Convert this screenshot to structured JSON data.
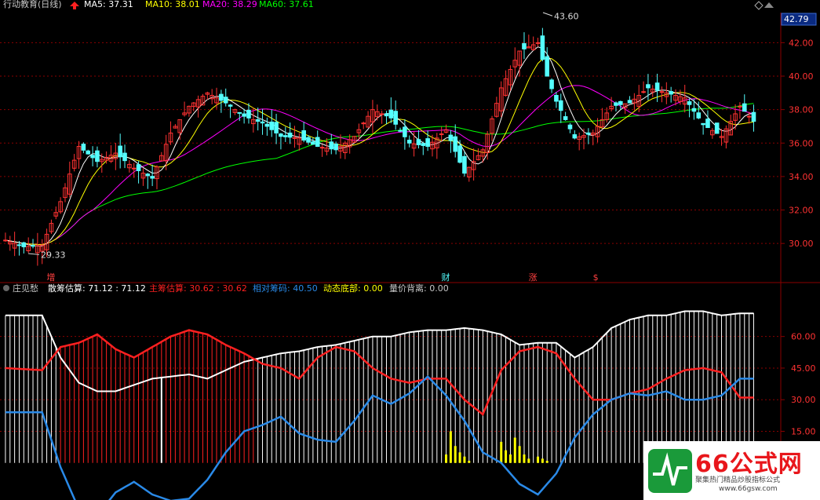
{
  "colors": {
    "up": "#ff3232",
    "down": "#54ffff",
    "ma5": "#ffffff",
    "ma10": "#ffff00",
    "ma20": "#ff00ff",
    "ma60": "#00ff00",
    "grid": "#8b0000",
    "axis": "#8b0000",
    "retail": "#ffffff",
    "main": "#ff2020",
    "relative": "#2a8ae8",
    "dynamic": "#ffff00"
  },
  "header": {
    "stock": "行动教育(日线)",
    "ma5": "MA5: 37.31",
    "ma10": "MA10: 38.01",
    "ma20": "MA20: 38.29",
    "ma60": "MA60: 37.61"
  },
  "price_box": "42.79",
  "markers": [
    {
      "text": "增",
      "idx": 10,
      "color": "#ff4040"
    },
    {
      "text": "财",
      "idx": 96,
      "color": "#54ffff"
    },
    {
      "text": "涨",
      "idx": 115,
      "color": "#ff4040"
    },
    {
      "text": "$",
      "idx": 129,
      "color": "#ff4040"
    }
  ],
  "indicator": {
    "name": "庄见愁",
    "retail": "散筹估算: 71.12 : 71.12",
    "main": "主筹估算: 30.62 : 30.62",
    "relative": "相对筹码: 40.50",
    "dynamic": "动态底部: 0.00",
    "divergence": "量价背离: 0.00"
  },
  "logo": {
    "main": "66公式网",
    "sub": "聚集热门精品炒股指标公式",
    "url": "www.66gsw.com"
  },
  "chart_data": [
    {
      "type": "candlestick",
      "title": "行动教育(日线)",
      "ylim": [
        28.6,
        43.8
      ],
      "yticks": [
        "30.00",
        "32.00",
        "34.00",
        "36.00",
        "38.00",
        "40.00",
        "42.00"
      ],
      "max_label": "43.60",
      "min_label": "29.33",
      "series": [
        {
          "name": "MA5",
          "value": 37.31
        },
        {
          "name": "MA10",
          "value": 38.01
        },
        {
          "name": "MA20",
          "value": 38.29
        },
        {
          "name": "MA60",
          "value": 37.61
        }
      ],
      "anchors": {
        "idx": [
          0,
          4,
          8,
          12,
          16,
          20,
          24,
          28,
          32,
          36,
          40,
          44,
          48,
          52,
          56,
          60,
          64,
          68,
          72,
          76,
          80,
          84,
          88,
          92,
          96,
          100,
          104,
          108,
          112,
          116,
          118,
          120,
          124,
          128,
          132,
          136,
          140,
          144,
          148,
          152,
          156,
          160,
          163
        ],
        "close": [
          30.2,
          29.8,
          29.9,
          32.5,
          35.8,
          34.9,
          35.4,
          34.5,
          33.9,
          36.6,
          38.2,
          39.0,
          38.4,
          37.6,
          37.2,
          36.4,
          36.3,
          35.8,
          35.6,
          36.4,
          38.0,
          37.5,
          36.0,
          35.8,
          36.8,
          34.2,
          35.6,
          39.3,
          41.5,
          42.0,
          40.0,
          38.5,
          36.3,
          36.6,
          38.2,
          38.4,
          39.3,
          39.0,
          38.7,
          37.1,
          36.4,
          38.2,
          37.3
        ]
      }
    },
    {
      "type": "line",
      "title": "庄见愁",
      "ylim": [
        -15,
        80
      ],
      "yticks": [
        "15.00",
        "30.00",
        "45.00",
        "60.00"
      ],
      "series": [
        {
          "name": "散筹估算",
          "value": 71.12,
          "anchors": {
            "idx": [
              0,
              8,
              12,
              16,
              20,
              24,
              28,
              32,
              36,
              40,
              44,
              48,
              52,
              56,
              60,
              64,
              68,
              72,
              76,
              80,
              84,
              88,
              92,
              96,
              100,
              104,
              108,
              112,
              116,
              120,
              124,
              128,
              132,
              136,
              140,
              144,
              148,
              152,
              156,
              160,
              163
            ],
            "v": [
              70,
              70,
              50,
              38,
              34,
              34,
              37,
              40,
              41,
              42,
              40,
              44,
              48,
              50,
              52,
              53,
              55,
              56,
              58,
              60,
              60,
              62,
              63,
              63,
              64,
              63,
              61,
              56,
              57,
              57,
              50,
              55,
              64,
              68,
              70,
              70,
              72,
              72,
              70,
              71,
              71
            ]
          }
        },
        {
          "name": "主筹估算",
          "value": 30.62,
          "anchors": {
            "idx": [
              0,
              8,
              12,
              16,
              20,
              24,
              28,
              32,
              36,
              40,
              44,
              48,
              52,
              56,
              60,
              64,
              68,
              72,
              76,
              80,
              84,
              88,
              92,
              96,
              100,
              104,
              108,
              112,
              116,
              120,
              124,
              128,
              132,
              136,
              140,
              144,
              148,
              152,
              156,
              160,
              163
            ],
            "v": [
              45,
              44,
              55,
              57,
              61,
              54,
              50,
              55,
              60,
              63,
              61,
              56,
              52,
              47,
              45,
              40,
              50,
              55,
              53,
              45,
              40,
              38,
              40,
              40,
              30,
              23,
              44,
              53,
              55,
              52,
              40,
              30,
              30,
              33,
              35,
              40,
              44,
              45,
              43,
              31,
              31
            ]
          }
        },
        {
          "name": "相对筹码",
          "value": 40.5,
          "anchors": {
            "idx": [
              0,
              8,
              12,
              16,
              20,
              24,
              28,
              32,
              36,
              40,
              44,
              48,
              52,
              56,
              60,
              64,
              68,
              72,
              76,
              80,
              84,
              88,
              92,
              96,
              100,
              104,
              108,
              112,
              116,
              120,
              124,
              128,
              132,
              136,
              140,
              144,
              148,
              152,
              156,
              160,
              163
            ],
            "v": [
              24,
              24,
              -2,
              -22,
              -25,
              -14,
              -9,
              -15,
              -18,
              -17,
              -8,
              5,
              15,
              18,
              22,
              14,
              11,
              10,
              20,
              32,
              28,
              33,
              41,
              32,
              20,
              5,
              0,
              -10,
              -15,
              -5,
              12,
              23,
              30,
              33,
              32,
              34,
              30,
              30,
              32,
              40,
              40
            ]
          }
        },
        {
          "name": "动态底部",
          "value": 0,
          "bars": {
            "idx": [
              96,
              97,
              98,
              99,
              100,
              101,
              108,
              109,
              110,
              111,
              112,
              113,
              114,
              116,
              117,
              118
            ],
            "v": [
              4,
              15,
              8,
              5,
              3,
              1,
              10,
              6,
              4,
              12,
              8,
              4,
              2,
              3,
              2,
              1
            ]
          }
        }
      ]
    }
  ]
}
